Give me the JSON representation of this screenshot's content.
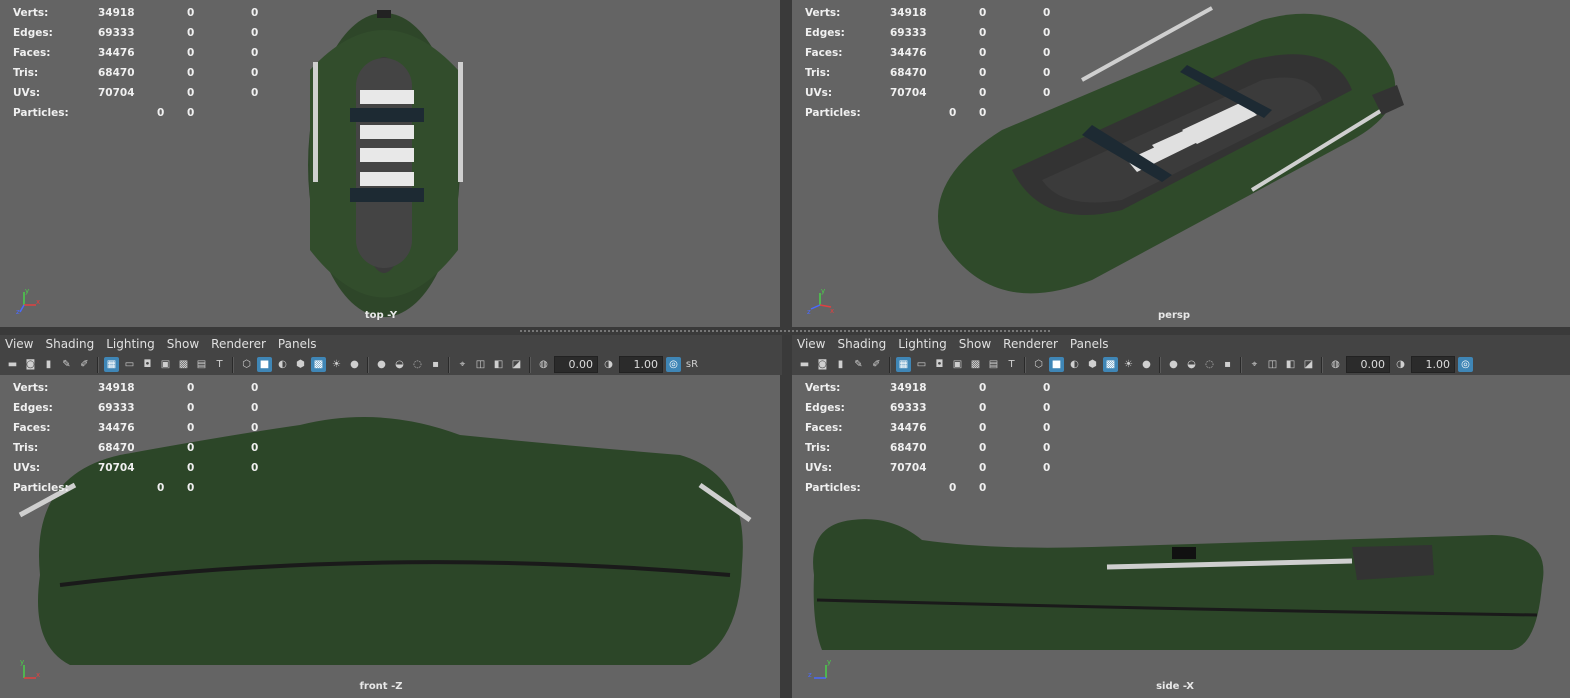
{
  "stats": {
    "rows": [
      {
        "label": "Verts:",
        "v1": "34918",
        "v2": "0",
        "v3": "0"
      },
      {
        "label": "Edges:",
        "v1": "69333",
        "v2": "0",
        "v3": "0"
      },
      {
        "label": "Faces:",
        "v1": "34476",
        "v2": "0",
        "v3": "0"
      },
      {
        "label": "Tris:",
        "v1": "68470",
        "v2": "0",
        "v3": "0"
      },
      {
        "label": "UVs:",
        "v1": "70704",
        "v2": "0",
        "v3": "0"
      }
    ],
    "particles": {
      "label": "Particles:",
      "v1": "0",
      "v2": "0"
    }
  },
  "viewports": {
    "top": {
      "camera": "top -Y"
    },
    "persp": {
      "camera": "persp"
    },
    "front": {
      "camera": "front -Z"
    },
    "side": {
      "camera": "side -X"
    }
  },
  "panel_menu": [
    "View",
    "Shading",
    "Lighting",
    "Show",
    "Renderer",
    "Panels"
  ],
  "toolbar": {
    "field1": "0.00",
    "field2": "1.00",
    "srgb": "sR"
  },
  "axis": {
    "top": [
      "y",
      "x",
      "z"
    ],
    "persp": [
      "y",
      "x",
      "z"
    ],
    "front": [
      "y",
      "x"
    ],
    "side": [
      "y",
      "z"
    ]
  },
  "colors": {
    "viewport_bg": "#646464",
    "boat_green": "#2f4a2a",
    "accent_blue": "#3f86b6"
  }
}
